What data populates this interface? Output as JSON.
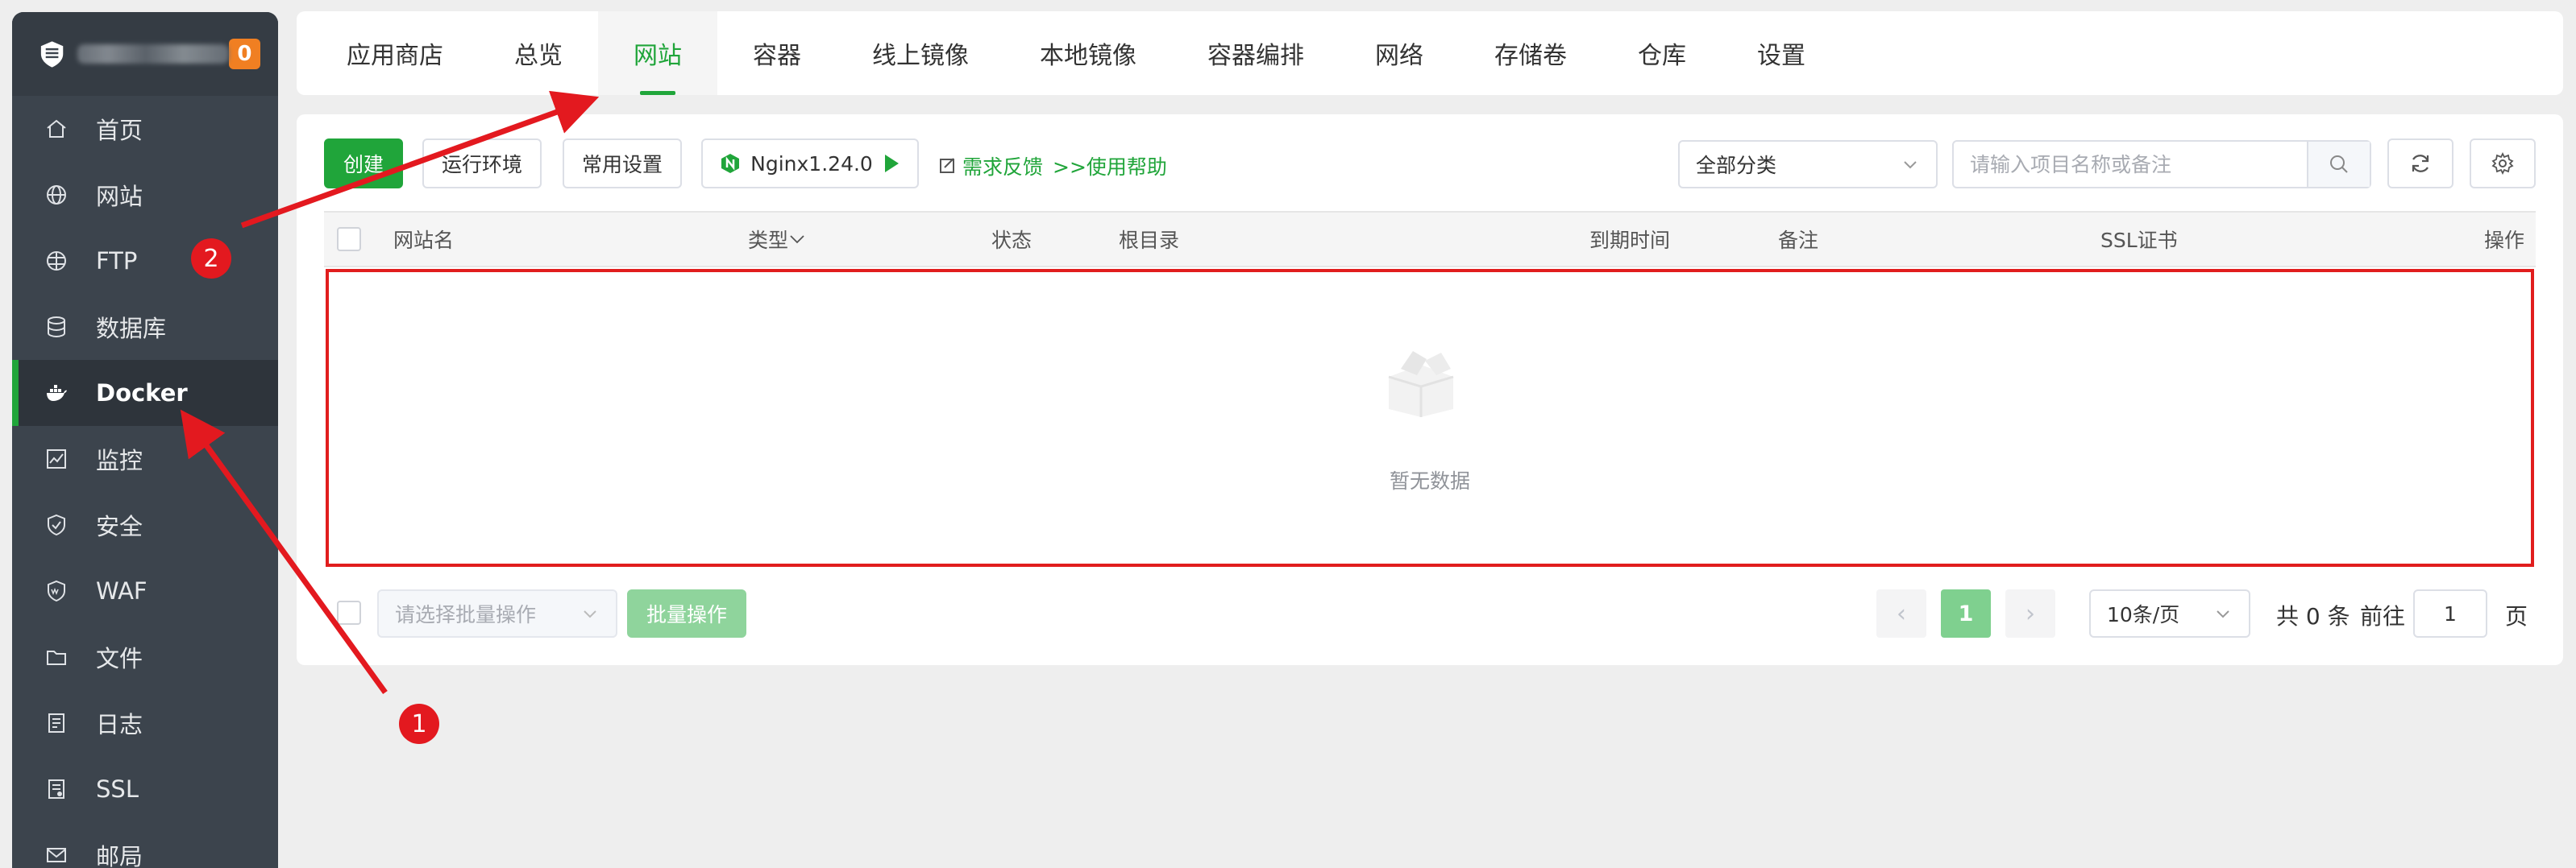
{
  "sidebar": {
    "badge_count": "0",
    "items": [
      {
        "label": "首页",
        "icon": "home-icon"
      },
      {
        "label": "网站",
        "icon": "globe-icon"
      },
      {
        "label": "FTP",
        "icon": "ftp-icon"
      },
      {
        "label": "数据库",
        "icon": "database-icon"
      },
      {
        "label": "Docker",
        "icon": "docker-icon",
        "active": true
      },
      {
        "label": "监控",
        "icon": "monitor-icon"
      },
      {
        "label": "安全",
        "icon": "shield-icon"
      },
      {
        "label": "WAF",
        "icon": "waf-icon"
      },
      {
        "label": "文件",
        "icon": "folder-icon"
      },
      {
        "label": "日志",
        "icon": "log-icon"
      },
      {
        "label": "SSL",
        "icon": "ssl-icon"
      },
      {
        "label": "邮局",
        "icon": "mail-icon"
      }
    ]
  },
  "tabs": [
    "应用商店",
    "总览",
    "网站",
    "容器",
    "线上镜像",
    "本地镜像",
    "容器编排",
    "网络",
    "存储卷",
    "仓库",
    "设置"
  ],
  "active_tab": "网站",
  "toolbar": {
    "create": "创建",
    "runtime_env": "运行环境",
    "common_settings": "常用设置",
    "nginx": "Nginx1.24.0",
    "feedback": "需求反馈",
    "help": ">>使用帮助",
    "category": "全部分类",
    "search_placeholder": "请输入项目名称或备注"
  },
  "table": {
    "columns": [
      "网站名",
      "类型",
      "状态",
      "根目录",
      "到期时间",
      "备注",
      "SSL证书",
      "操作"
    ],
    "empty_text": "暂无数据"
  },
  "footer": {
    "batch_placeholder": "请选择批量操作",
    "batch_button": "批量操作",
    "current_page": "1",
    "page_size": "10条/页",
    "total": "共 0 条",
    "goto": "前往",
    "goto_value": "1",
    "page_unit": "页"
  },
  "annotations": {
    "marker_1": "1",
    "marker_2": "2"
  },
  "colors": {
    "accent": "#20a53a",
    "sidebar_bg": "#3c444d",
    "badge": "#f07f22",
    "annotation_red": "#e3191f"
  }
}
